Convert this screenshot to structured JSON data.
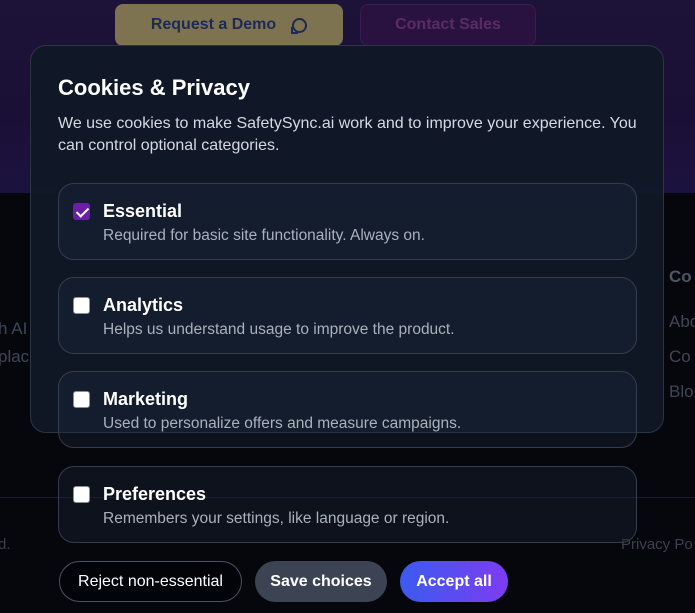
{
  "background": {
    "hero_buttons": {
      "demo_label": "Request a Demo",
      "contact_label": "Contact Sales"
    },
    "fragments": {
      "left_1": "h AI",
      "left_2": "plac",
      "right_heading": "Co",
      "right_1": "Abo",
      "right_2": "Co",
      "right_3": "Blo",
      "bottom_left": "d.",
      "bottom_right": "Privacy Po"
    }
  },
  "modal": {
    "title": "Cookies & Privacy",
    "description": "We use cookies to make SafetySync.ai work and to improve your experience. You can control optional categories.",
    "categories": [
      {
        "name": "Essential",
        "description": "Required for basic site functionality. Always on.",
        "checked": true
      },
      {
        "name": "Analytics",
        "description": "Helps us understand usage to improve the product.",
        "checked": false
      },
      {
        "name": "Marketing",
        "description": "Used to personalize offers and measure campaigns.",
        "checked": false
      },
      {
        "name": "Preferences",
        "description": "Remembers your settings, like language or region.",
        "checked": false
      }
    ],
    "actions": {
      "reject": "Reject non-essential",
      "save": "Save choices",
      "accept": "Accept all"
    }
  },
  "colors": {
    "accent_purple": "#6b1fa8",
    "accept_gradient_start": "#3b5bf0",
    "accept_gradient_end": "#7d3cf0"
  }
}
